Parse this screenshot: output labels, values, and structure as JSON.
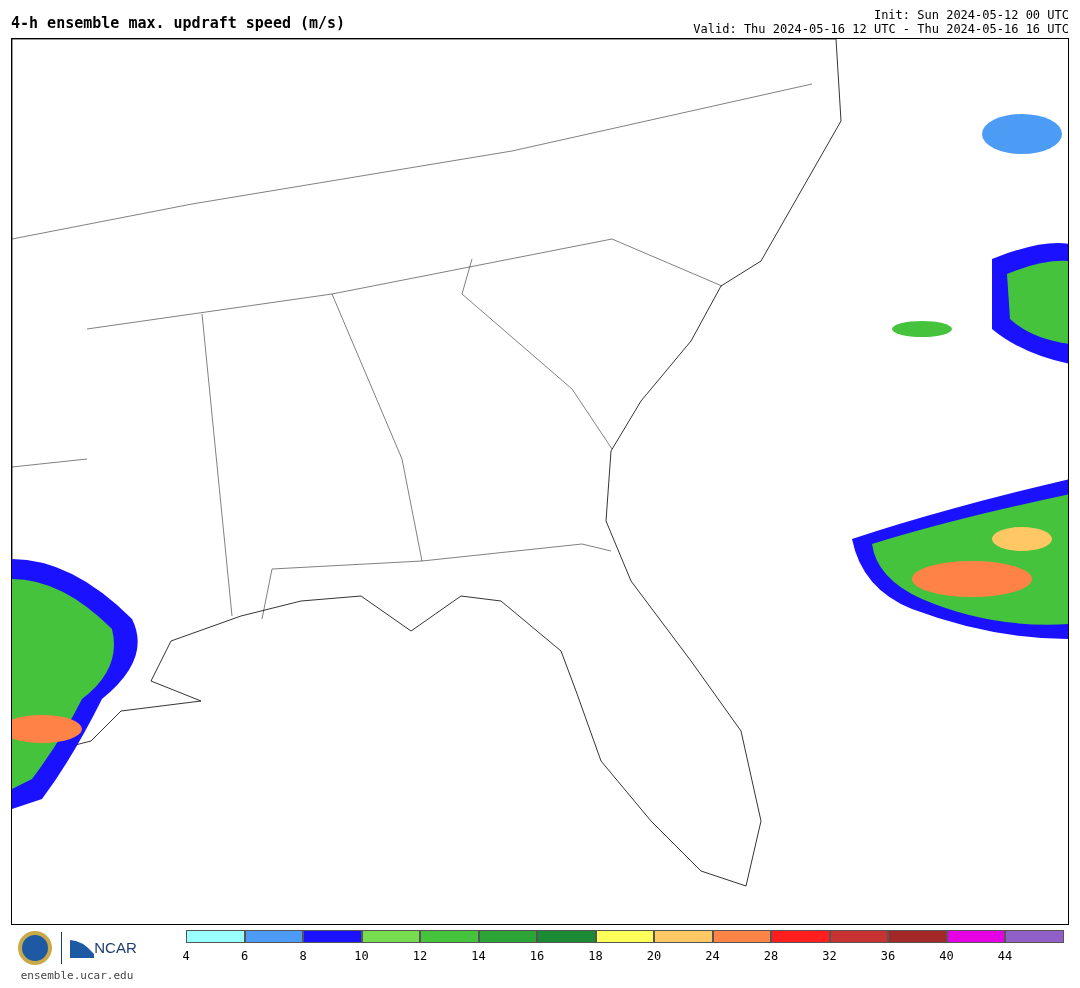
{
  "title": "4-h ensemble max. updraft speed (m/s)",
  "init": "Init: Sun 2024-05-12 00 UTC",
  "valid": "Valid: Thu 2024-05-16 12 UTC - Thu 2024-05-16 16 UTC",
  "logo": {
    "org": "NCAR",
    "url": "ensemble.ucar.edu"
  },
  "colorbar": [
    {
      "label": "4",
      "color": "#99ffff"
    },
    {
      "label": "6",
      "color": "#4c9cf5"
    },
    {
      "label": "8",
      "color": "#1a12ff"
    },
    {
      "label": "10",
      "color": "#78dc50"
    },
    {
      "label": "12",
      "color": "#45c33d"
    },
    {
      "label": "14",
      "color": "#2ca536"
    },
    {
      "label": "16",
      "color": "#1b8a35"
    },
    {
      "label": "18",
      "color": "#ffff5a"
    },
    {
      "label": "20",
      "color": "#ffc864"
    },
    {
      "label": "24",
      "color": "#ff8246"
    },
    {
      "label": "28",
      "color": "#ff1e1e"
    },
    {
      "label": "32",
      "color": "#c83232"
    },
    {
      "label": "36",
      "color": "#a52828"
    },
    {
      "label": "40",
      "color": "#e600e6"
    },
    {
      "label": "44",
      "color": "#9060c8"
    }
  ]
}
